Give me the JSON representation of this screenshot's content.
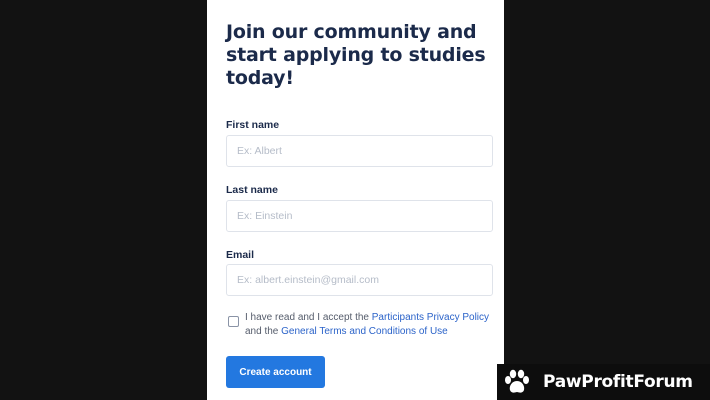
{
  "form": {
    "heading": "Join our community and start applying to studies today!",
    "first_name": {
      "label": "First name",
      "placeholder": "Ex: Albert",
      "value": ""
    },
    "last_name": {
      "label": "Last name",
      "placeholder": "Ex: Einstein",
      "value": ""
    },
    "email": {
      "label": "Email",
      "placeholder": "Ex: albert.einstein@gmail.com",
      "value": ""
    },
    "consent": {
      "checked": false,
      "text_prefix": "I have read and I accept the ",
      "privacy_link": "Participants Privacy Policy",
      "text_middle": " and the ",
      "terms_link": "General Terms and Conditions of Use"
    },
    "submit_label": "Create account"
  },
  "watermark": {
    "icon": "paw-icon",
    "text": "PawProfitForum"
  },
  "colors": {
    "background": "#121212",
    "heading": "#1b2a4a",
    "link": "#2b63c9",
    "button": "#2378e0"
  }
}
